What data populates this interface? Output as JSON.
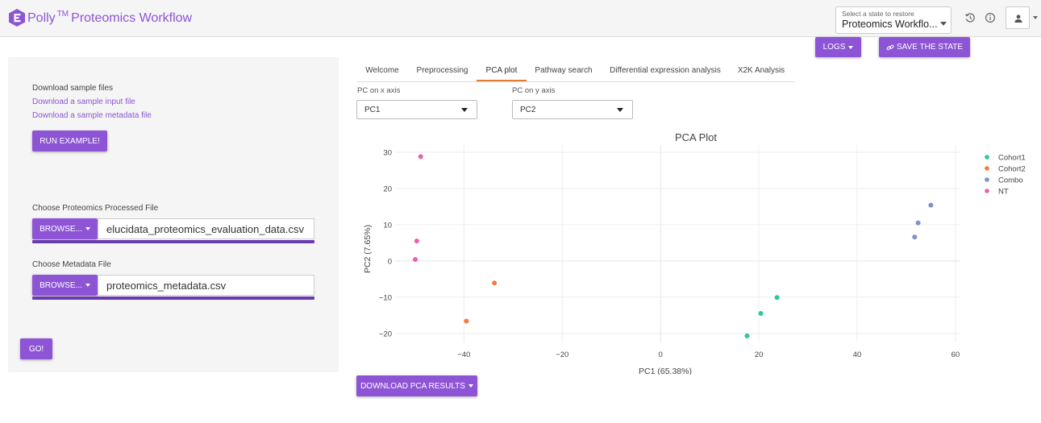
{
  "app": {
    "brand": "Polly",
    "trademark": "TM",
    "title": "Proteomics Workflow"
  },
  "header": {
    "state_select": {
      "label": "Select a state to restore",
      "value": "Proteomics Workflo..."
    },
    "icons": [
      "history-icon",
      "info-icon",
      "user-icon"
    ]
  },
  "actions": {
    "logs_label": "LOGS",
    "save_state_label": "SAVE THE STATE"
  },
  "left_panel": {
    "download_heading": "Download sample files",
    "download_input_link": "Download a sample input file",
    "download_metadata_link": "Download a sample metadata file",
    "run_example_label": "RUN EXAMPLE!",
    "processed_file_label": "Choose Proteomics Processed File",
    "processed_browse_label": "BROWSE...",
    "processed_file_value": "elucidata_proteomics_evaluation_data.csv",
    "metadata_file_label": "Choose Metadata File",
    "metadata_browse_label": "BROWSE...",
    "metadata_file_value": "proteomics_metadata.csv",
    "go_label": "GO!"
  },
  "tabs": [
    {
      "label": "Welcome",
      "active": false
    },
    {
      "label": "Preprocessing",
      "active": false
    },
    {
      "label": "PCA plot",
      "active": true
    },
    {
      "label": "Pathway search",
      "active": false
    },
    {
      "label": "Differential expression analysis",
      "active": false
    },
    {
      "label": "X2K Analysis",
      "active": false
    }
  ],
  "pc_controls": {
    "x_label": "PC on x axis",
    "x_value": "PC1",
    "y_label": "PC on y axis",
    "y_value": "PC2"
  },
  "download_pca_label": "DOWNLOAD PCA RESULTS",
  "colors": {
    "accent": "#8e54d6",
    "tab_active": "#e57c2e"
  },
  "chart_data": {
    "type": "scatter",
    "title": "PCA Plot",
    "xlabel": "PC1 (65.38%)",
    "ylabel": "PC2 (7.65%)",
    "xlim": [
      -54,
      61
    ],
    "ylim": [
      -22.5,
      32
    ],
    "xticks": [
      -40,
      -20,
      0,
      20,
      40,
      60
    ],
    "xtick_labels": [
      "−40",
      "−20",
      "0",
      "20",
      "40",
      "60"
    ],
    "yticks": [
      -20,
      -10,
      0,
      10,
      20,
      30
    ],
    "ytick_labels": [
      "−20",
      "−10",
      "0",
      "10",
      "20",
      "30"
    ],
    "grid": true,
    "legend_position": "right",
    "series": [
      {
        "name": "Cohort1",
        "color": "#2ec4a0",
        "points": [
          [
            17.6,
            -20.7
          ],
          [
            20.4,
            -14.5
          ],
          [
            23.7,
            -10.1
          ]
        ]
      },
      {
        "name": "Cohort2",
        "color": "#f47a42",
        "points": [
          [
            -33.8,
            -6.1
          ],
          [
            -39.5,
            -16.6
          ]
        ]
      },
      {
        "name": "Combo",
        "color": "#8090c8",
        "points": [
          [
            55.0,
            15.4
          ],
          [
            52.4,
            10.5
          ],
          [
            51.7,
            6.6
          ]
        ]
      },
      {
        "name": "NT",
        "color": "#ef5db0",
        "points": [
          [
            -48.8,
            28.8
          ],
          [
            -49.6,
            5.5
          ],
          [
            -49.9,
            0.4
          ]
        ]
      }
    ]
  }
}
